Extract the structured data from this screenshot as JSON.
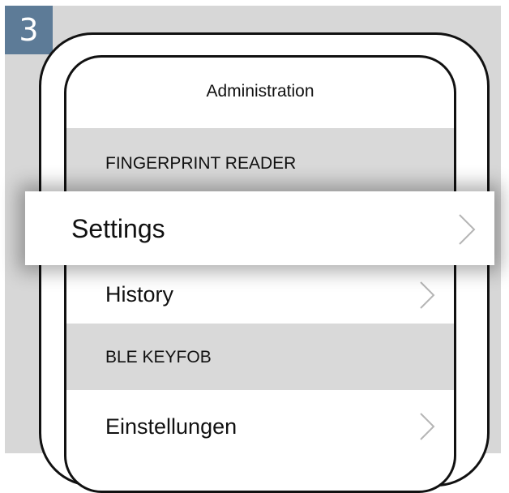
{
  "step": {
    "number": "3",
    "color": "#5d7b97"
  },
  "screen": {
    "title": "Administration",
    "sections": [
      {
        "header": "FINGERPRINT READER",
        "items": [
          {
            "label": "Settings",
            "icon": "chevron-right-icon",
            "highlighted": true
          },
          {
            "label": "History",
            "icon": "chevron-right-icon"
          }
        ]
      },
      {
        "header": "BLE KEYFOB",
        "items": [
          {
            "label": "Einstellungen",
            "icon": "chevron-right-icon"
          }
        ]
      }
    ]
  },
  "colors": {
    "background_panel": "#d7d7d7",
    "section_header": "#d9d9d9",
    "chevron": "#b5b5b5",
    "text": "#111111"
  }
}
